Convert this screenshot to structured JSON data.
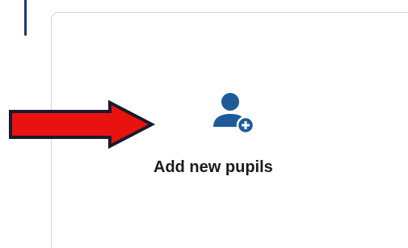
{
  "tile": {
    "label": "Add new pupils",
    "icon": "add-user-icon"
  },
  "annotation": {
    "icon": "arrow-right-icon",
    "color": "#e8120f",
    "outline_color": "#1a1a2e"
  },
  "colors": {
    "accent": "#1f5a99",
    "left_accent": "#1f3a6e",
    "card_border": "#d6d6d6"
  }
}
